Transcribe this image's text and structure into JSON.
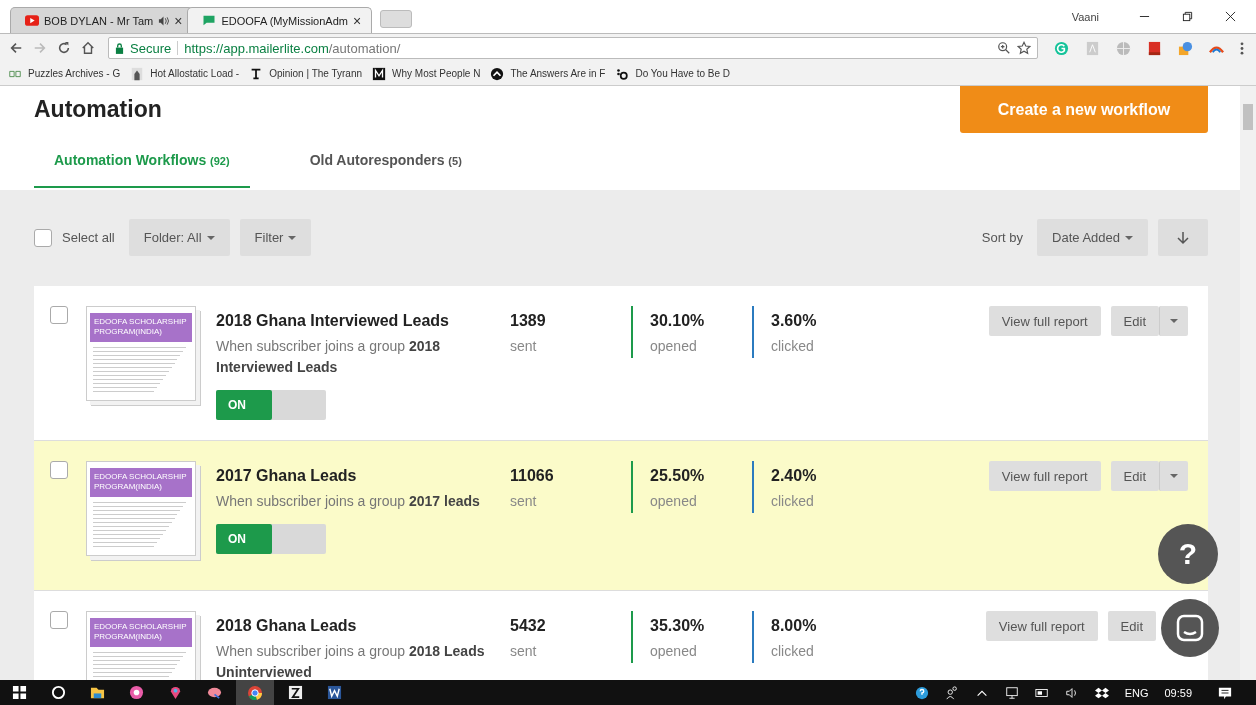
{
  "browser": {
    "tabs": [
      {
        "title": "BOB DYLAN - Mr Tam",
        "kind": "youtube",
        "audio": true,
        "close": "×",
        "selected": false
      },
      {
        "title": "EDOOFA (MyMissionAdm",
        "kind": "chat",
        "audio": false,
        "close": "×",
        "selected": true
      }
    ],
    "profile": "Vaani",
    "secure_label": "Secure",
    "url_host": "https://app.mailerlite.com",
    "url_path": "/automation/",
    "bookmarks": [
      {
        "title": "Puzzles Archives - G",
        "kind": "gg"
      },
      {
        "title": "Hot Allostatic Load -",
        "kind": "person"
      },
      {
        "title": "Opinion | The Tyrann",
        "kind": "nyt"
      },
      {
        "title": "Why Most People N",
        "kind": "medium"
      },
      {
        "title": "The Answers Are in F",
        "kind": "circle"
      },
      {
        "title": "Do You Have to Be D",
        "kind": "dots"
      }
    ]
  },
  "page": {
    "title": "Automation",
    "create_button": "Create a new workflow",
    "tabs": [
      {
        "label": "Automation Workflows",
        "count": "(92)",
        "selected": true
      },
      {
        "label": "Old Autoresponders",
        "count": "(5)",
        "selected": false
      }
    ],
    "toolbar": {
      "select_all": "Select all",
      "select_all_checked": false,
      "folder": "Folder: All",
      "filter": "Filter",
      "sort_label": "Sort by",
      "sort": "Date Added"
    },
    "workflows": [
      {
        "thumb_heading": "EDOOFA SCHOLARSHIP PROGRAM(INDIA)",
        "title": "2018 Ghana Interviewed Leads",
        "description": "When subscriber joins a group **2018 Interviewed Leads**",
        "sent": "1389",
        "sent_label": "sent",
        "opened": "30.10%",
        "opened_label": "opened",
        "clicked": "3.60%",
        "clicked_label": "clicked",
        "on": true,
        "on_label": "ON",
        "checked": false,
        "highlighted": false,
        "report": "View full report",
        "edit": "Edit",
        "menu_button": true
      },
      {
        "thumb_heading": "EDOOFA SCHOLARSHIP PROGRAM(INDIA)",
        "title": "2017 Ghana Leads",
        "description": "When subscriber joins a group **2017 leads**",
        "sent": "11066",
        "sent_label": "sent",
        "opened": "25.50%",
        "opened_label": "opened",
        "clicked": "2.40%",
        "clicked_label": "clicked",
        "on": true,
        "on_label": "ON",
        "checked": false,
        "highlighted": true,
        "report": "View full report",
        "edit": "Edit",
        "menu_button": true
      },
      {
        "thumb_heading": "EDOOFA SCHOLARSHIP PROGRAM(INDIA)",
        "title": "2018 Ghana Leads",
        "description": "When subscriber joins a group **2018 Leads Uninterviewed**",
        "sent": "5432",
        "sent_label": "sent",
        "opened": "35.30%",
        "opened_label": "opened",
        "clicked": "8.00%",
        "clicked_label": "clicked",
        "checked": false,
        "highlighted": false,
        "report": "View full report",
        "edit": "Edit",
        "menu_button": false
      }
    ],
    "help_button": "?"
  },
  "taskbar": {
    "language": "ENG",
    "time": "09:59"
  }
}
